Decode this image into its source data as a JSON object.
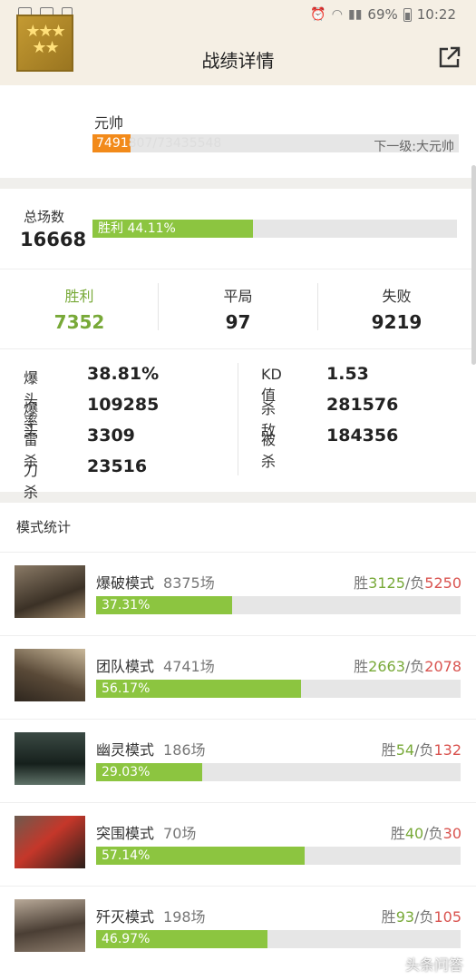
{
  "status_bar": {
    "battery": "69%",
    "time": "10:22"
  },
  "header": {
    "title": "战绩详情",
    "back_icon": "chevron-left-icon",
    "share_icon": "share-icon"
  },
  "rank": {
    "name": "元帅",
    "badge_label": "MARSHAL",
    "xp_current": "7491",
    "xp_rest": "807/73435548",
    "next_level": "下一级:大元帅",
    "colors": {
      "xp_fill": "#f28a1a"
    }
  },
  "totals": {
    "label": "总场数",
    "value": "16668",
    "win_rate_text": "胜利 44.11%",
    "win_rate": 0.4411
  },
  "wdl": {
    "win": {
      "label": "胜利",
      "value": "7352"
    },
    "draw": {
      "label": "平局",
      "value": "97"
    },
    "loss": {
      "label": "失败",
      "value": "9219"
    }
  },
  "stats": {
    "left": [
      {
        "k": "爆头率",
        "v": "38.81%"
      },
      {
        "k": "爆头",
        "v": "109285"
      },
      {
        "k": "雷杀",
        "v": "3309"
      },
      {
        "k": "刀杀",
        "v": "23516"
      }
    ],
    "right": [
      {
        "k": "KD值",
        "v": "1.53"
      },
      {
        "k": "杀敌",
        "v": "281576"
      },
      {
        "k": "被杀",
        "v": "184356"
      }
    ]
  },
  "modes": {
    "heading": "模式统计",
    "items": [
      {
        "name": "爆破模式",
        "count": "8375场",
        "w_label": "胜",
        "w": "3125",
        "sep": "/负",
        "l": "5250",
        "pct_text": "37.31%",
        "pct": 0.3731,
        "thumb": "demolition-thumbnail"
      },
      {
        "name": "团队模式",
        "count": "4741场",
        "w_label": "胜",
        "w": "2663",
        "sep": "/负",
        "l": "2078",
        "pct_text": "56.17%",
        "pct": 0.5617,
        "thumb": "team-thumbnail"
      },
      {
        "name": "幽灵模式",
        "count": "186场",
        "w_label": "胜",
        "w": "54",
        "sep": "/负",
        "l": "132",
        "pct_text": "29.03%",
        "pct": 0.2903,
        "thumb": "ghost-thumbnail"
      },
      {
        "name": "突围模式",
        "count": "70场",
        "w_label": "胜",
        "w": "40",
        "sep": "/负",
        "l": "30",
        "pct_text": "57.14%",
        "pct": 0.5714,
        "thumb": "breakout-thumbnail"
      },
      {
        "name": "歼灭模式",
        "count": "198场",
        "w_label": "胜",
        "w": "93",
        "sep": "/负",
        "l": "105",
        "pct_text": "46.97%",
        "pct": 0.4697,
        "thumb": "annihilation-thumbnail"
      }
    ]
  },
  "watermark": "头条问答",
  "colors": {
    "green": "#8cc540",
    "win_text": "#78a938",
    "loss_text": "#d9534f",
    "bar_bg": "#e6e6e6"
  }
}
